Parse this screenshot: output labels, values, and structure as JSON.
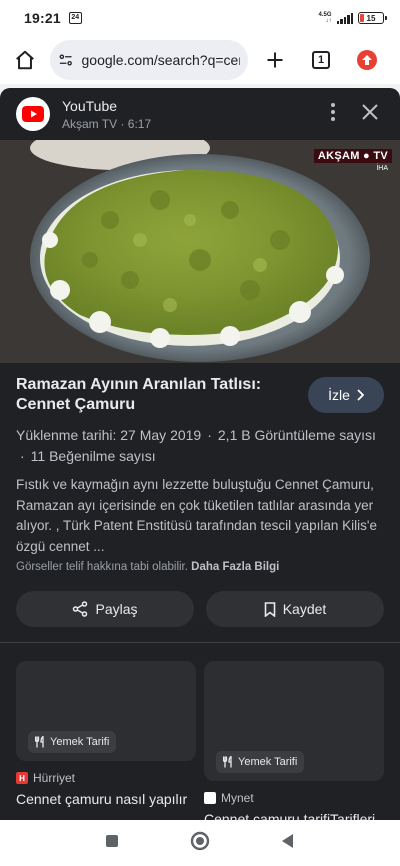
{
  "status_bar": {
    "time": "19:21",
    "notification_badge": "24",
    "network_top": "4.5G",
    "network_bottom": "↓↑",
    "battery": "15"
  },
  "toolbar": {
    "url": "google.com/search?q=cennet",
    "tab_count": "1"
  },
  "panel": {
    "source_name": "YouTube",
    "source_meta": "Akşam TV · 6:17",
    "video_overlay": "AKŞAM ● TV",
    "video_overlay_sub": "İHA",
    "title": "Ramazan Ayının Aranılan Tatlısı: Cennet Çamuru",
    "watch_label": "İzle",
    "upload_date": "Yüklenme tarihi: 27 May 2019",
    "views": "2,1 B Görüntüleme sayısı",
    "likes": "11 Beğenilme sayısı",
    "description": "Fıstık ve kaymağın aynı lezzette buluştuğu Cennet Çamuru, Ramazan ayı içerisinde en çok tüketilen tatlılar arasında yer alıyor. , Türk Patent Enstitüsü tarafından tescil yapılan Kilis'e özgü cennet ...",
    "copyright": "Görseller telif hakkına tabi olabilir.",
    "more_info": "Daha Fazla Bilgi",
    "share_label": "Paylaş",
    "save_label": "Kaydet"
  },
  "cards": [
    {
      "chip": "Yemek Tarifi",
      "source": "Hürriyet",
      "source_icon": "H",
      "source_color": "#e53935",
      "title": "Cennet çamuru nasıl yapılır"
    },
    {
      "chip": "Yemek Tarifi",
      "source": "Mynet",
      "source_icon": "",
      "source_color": "#ffffff",
      "title": "Cennet çamuru tarifiTarifleri"
    }
  ],
  "colors": {
    "panel_bg": "#202124",
    "watch_button": "#394457",
    "update_badge": "#e84134",
    "youtube_red": "#ff0000"
  }
}
